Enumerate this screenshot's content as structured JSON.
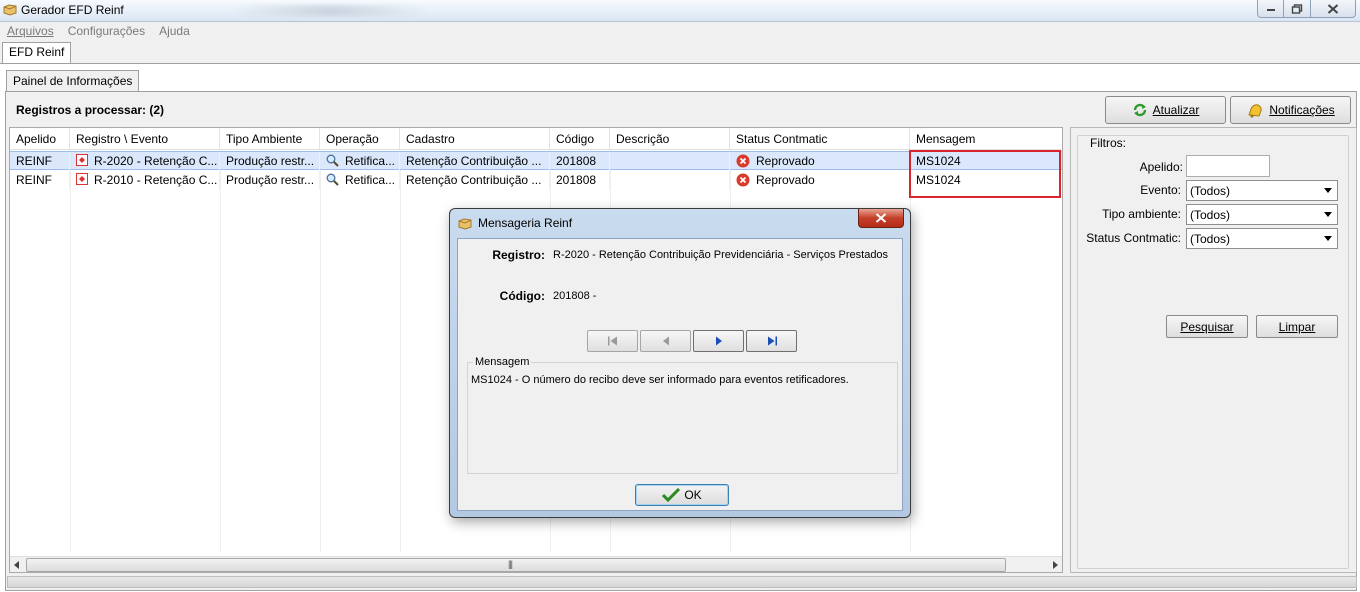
{
  "window": {
    "title": "Gerador EFD Reinf",
    "colors": {
      "titlebar": "#dbe6f3",
      "accent": "#d9252b"
    }
  },
  "menu": {
    "items": [
      {
        "label": "Arquivos"
      },
      {
        "label": "Configurações"
      },
      {
        "label": "Ajuda"
      }
    ]
  },
  "main_tab": {
    "label": "EFD Reinf"
  },
  "sub_tab": {
    "label": "Painel de Informações"
  },
  "registros_label": "Registros a processar: (2)",
  "toolbar": {
    "atualizar_label": "Atualizar",
    "notificacoes_label": "Notificações"
  },
  "grid": {
    "columns": [
      "Apelido",
      "Registro \\ Evento",
      "Tipo Ambiente",
      "Operação",
      "Cadastro",
      "Código",
      "Descrição",
      "Status Contmatic",
      "Mensagem"
    ],
    "rows": [
      {
        "apelido": "REINF",
        "registro": "R-2020 - Retenção C...",
        "tipo_ambiente": "Produção restr...",
        "operacao": "Retifica...",
        "cadastro": "Retenção Contribuição ...",
        "codigo": "201808",
        "descricao": "",
        "status": "Reprovado",
        "mensagem": "MS1024"
      },
      {
        "apelido": "REINF",
        "registro": "R-2010 - Retenção C...",
        "tipo_ambiente": "Produção restr...",
        "operacao": "Retifica...",
        "cadastro": "Retenção Contribuição ...",
        "codigo": "201808",
        "descricao": "",
        "status": "Reprovado",
        "mensagem": "MS1024"
      }
    ]
  },
  "filters": {
    "legend": "Filtros:",
    "apelido_label": "Apelido:",
    "apelido_value": "",
    "evento_label": "Evento:",
    "evento_value": "(Todos)",
    "tipo_ambiente_label": "Tipo ambiente:",
    "tipo_ambiente_value": "(Todos)",
    "status_label": "Status Contmatic:",
    "status_value": "(Todos)",
    "pesquisar_label": "Pesquisar",
    "limpar_label": "Limpar"
  },
  "dialog": {
    "title": "Mensageria Reinf",
    "registro_label": "Registro:",
    "registro_value": "R-2020 - Retenção Contribuição Previdenciária - Serviços Prestados",
    "codigo_label": "Código:",
    "codigo_value": "201808 -",
    "mensagem_legend": "Mensagem",
    "mensagem_text": "MS1024 - O número do recibo deve ser informado para eventos retificadores.",
    "ok_label": "OK"
  }
}
